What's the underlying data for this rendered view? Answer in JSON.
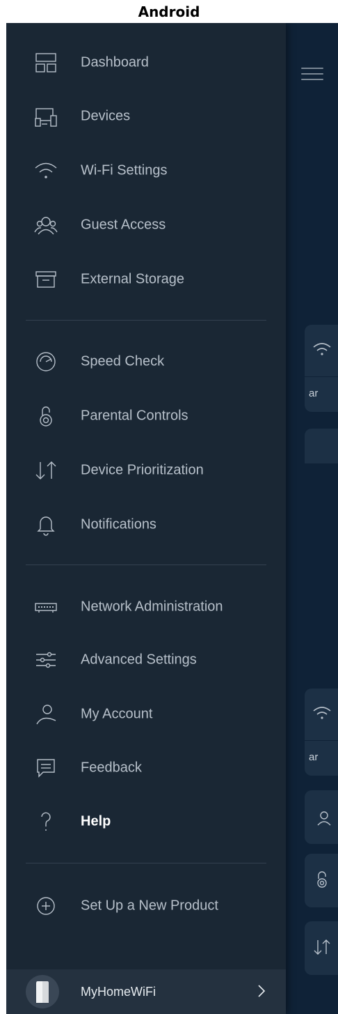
{
  "platform_title": "Android",
  "menu": {
    "group1": [
      {
        "label": "Dashboard",
        "icon": "dashboard-icon"
      },
      {
        "label": "Devices",
        "icon": "devices-icon"
      },
      {
        "label": "Wi-Fi Settings",
        "icon": "wifi-icon"
      },
      {
        "label": "Guest Access",
        "icon": "guest-access-icon"
      },
      {
        "label": "External Storage",
        "icon": "storage-box-icon"
      }
    ],
    "group2": [
      {
        "label": "Speed Check",
        "icon": "speedometer-icon"
      },
      {
        "label": "Parental Controls",
        "icon": "parental-lock-icon"
      },
      {
        "label": "Device Prioritization",
        "icon": "priority-arrows-icon"
      },
      {
        "label": "Notifications",
        "icon": "bell-icon"
      }
    ],
    "group3": [
      {
        "label": "Network Administration",
        "icon": "router-icon"
      },
      {
        "label": "Advanced Settings",
        "icon": "sliders-icon"
      },
      {
        "label": "My Account",
        "icon": "person-icon"
      },
      {
        "label": "Feedback",
        "icon": "chat-bubble-icon"
      },
      {
        "label": "Help",
        "icon": "question-icon",
        "active": true
      }
    ],
    "group4": [
      {
        "label": "Set Up a New Product",
        "icon": "plus-circle-icon"
      }
    ]
  },
  "footer": {
    "network_name": "MyHomeWiFi",
    "icon": "node-avatar-icon",
    "action_icon": "chevron-right-icon"
  },
  "background": {
    "card_text_1": "ar",
    "card_text_2": "ar"
  },
  "colors": {
    "drawer_bg": "#1a2734",
    "screen_bg": "#0c1f33",
    "label": "#b7c0ca",
    "active_label": "#ffffff"
  }
}
